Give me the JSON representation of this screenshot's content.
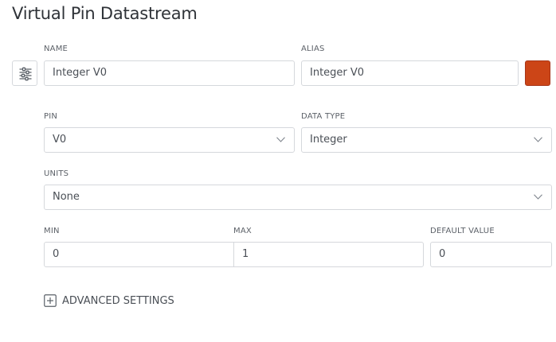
{
  "title": "Virtual Pin Datastream",
  "icons": {
    "settings": "sliders-icon",
    "expand": "plus-square-icon",
    "dropdown": "chevron-down-icon"
  },
  "colors": {
    "datastream_color": "#CC4517"
  },
  "form": {
    "name": {
      "label": "NAME",
      "value": "Integer V0"
    },
    "alias": {
      "label": "ALIAS",
      "value": "Integer V0"
    },
    "pin": {
      "label": "PIN",
      "value": "V0"
    },
    "data_type": {
      "label": "DATA TYPE",
      "value": "Integer"
    },
    "units": {
      "label": "UNITS",
      "value": "None"
    },
    "min": {
      "label": "MIN",
      "value": "0"
    },
    "max": {
      "label": "MAX",
      "value": "1"
    },
    "default_value": {
      "label": "DEFAULT VALUE",
      "value": "0"
    }
  },
  "advanced": {
    "label": "ADVANCED SETTINGS"
  }
}
